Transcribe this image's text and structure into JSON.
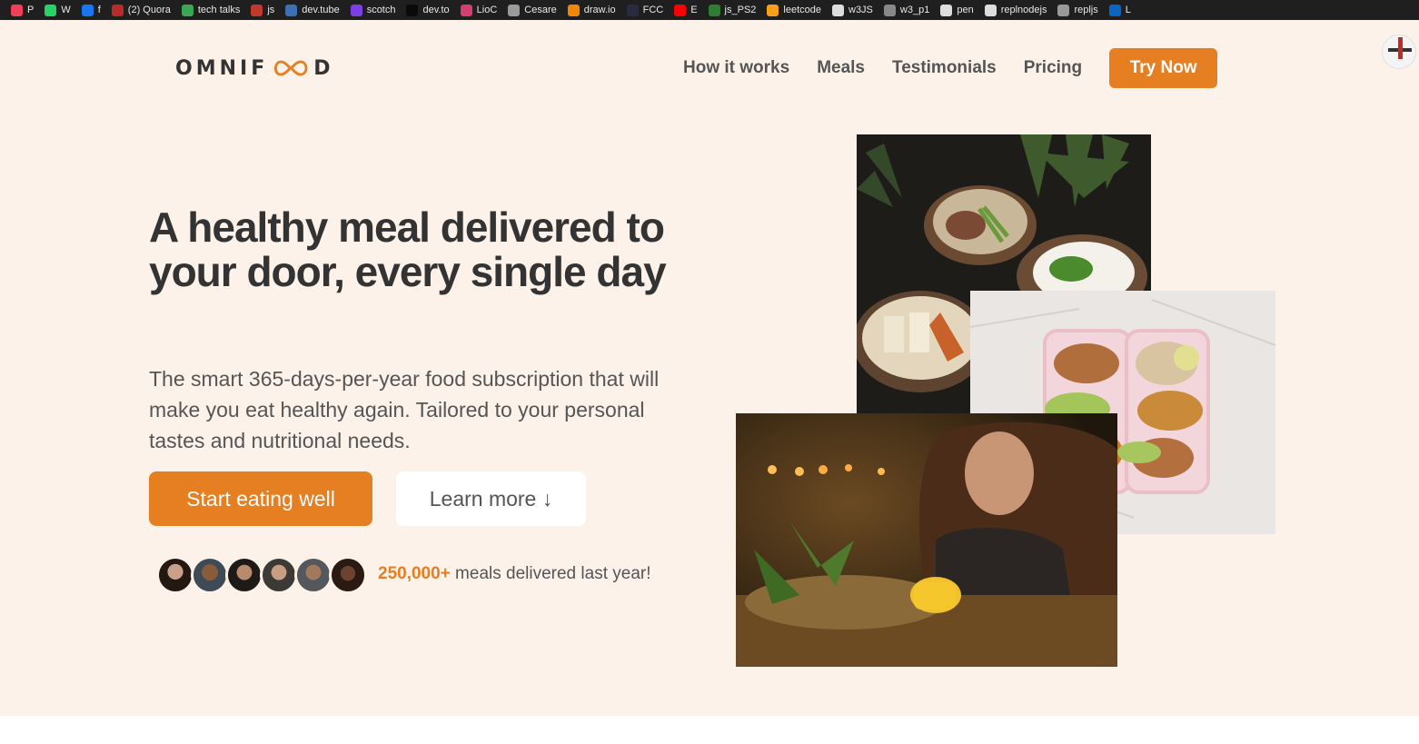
{
  "bookmarks": [
    {
      "label": "P",
      "icon": "pocket-icon",
      "color": "#ef4056"
    },
    {
      "label": "W",
      "icon": "whatsapp-icon",
      "color": "#25d366"
    },
    {
      "label": "f",
      "icon": "facebook-icon",
      "color": "#1877f2"
    },
    {
      "label": "(2) Quora",
      "icon": "quora-icon",
      "color": "#b92b27"
    },
    {
      "label": "tech talks",
      "icon": "techtalks-icon",
      "color": "#3aa757"
    },
    {
      "label": "js",
      "icon": "js-icon",
      "color": "#c0392b"
    },
    {
      "label": "dev.tube",
      "icon": "devtube-icon",
      "color": "#3d6fb6"
    },
    {
      "label": "scotch",
      "icon": "scotch-icon",
      "color": "#7b3fe4"
    },
    {
      "label": "dev.to",
      "icon": "devto-icon",
      "color": "#0a0a0a"
    },
    {
      "label": "LioC",
      "icon": "lioc-icon",
      "color": "#d43f6f"
    },
    {
      "label": "Cesare",
      "icon": "cesare-icon",
      "color": "#9a9a9a"
    },
    {
      "label": "draw.io",
      "icon": "drawio-icon",
      "color": "#f08705"
    },
    {
      "label": "FCC",
      "icon": "fcc-icon",
      "color": "#2a2a40"
    },
    {
      "label": "E",
      "icon": "youtube-icon",
      "color": "#ff0000"
    },
    {
      "label": "js_PS2",
      "icon": "jsps2-icon",
      "color": "#2e7d32"
    },
    {
      "label": "leetcode",
      "icon": "leetcode-icon",
      "color": "#f89f1b"
    },
    {
      "label": "w3JS",
      "icon": "w3js-icon",
      "color": "#dddddd"
    },
    {
      "label": "w3_p1",
      "icon": "w3p1-icon",
      "color": "#888888"
    },
    {
      "label": "pen",
      "icon": "codepen-icon",
      "color": "#dddddd"
    },
    {
      "label": "replnodejs",
      "icon": "repl-icon",
      "color": "#dddddd"
    },
    {
      "label": "repljs",
      "icon": "repl-icon",
      "color": "#999999"
    },
    {
      "label": "L",
      "icon": "linkedin-icon",
      "color": "#0a66c2"
    }
  ],
  "header": {
    "logo_left": "OMNIF",
    "logo_right": "D",
    "nav": [
      "How it works",
      "Meals",
      "Testimonials",
      "Pricing"
    ],
    "cta": "Try Now"
  },
  "hero": {
    "headline": "A healthy meal delivered to your door, every single day",
    "description": "The smart 365-days-per-year food subscription that will make you eat healthy again. Tailored to your personal tastes and nutritional needs.",
    "primary_button": "Start eating well",
    "secondary_button": "Learn more ↓",
    "delivered_count": "250,000+",
    "delivered_text": " meals delivered last year!"
  },
  "colors": {
    "accent": "#e67e22",
    "hero_bg": "#fdf2e9",
    "headline": "#333333",
    "text": "#555555"
  }
}
